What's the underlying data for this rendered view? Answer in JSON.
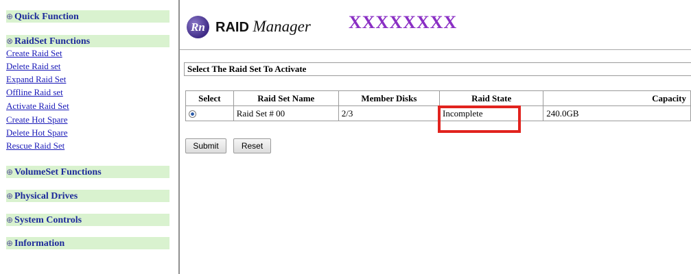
{
  "sidebar": {
    "quick_function": {
      "toggle": "⊕",
      "label": "Quick Function"
    },
    "raidset_functions": {
      "toggle": "⊗",
      "label": "RaidSet Functions"
    },
    "raidset_links": [
      "Create Raid Set",
      "Delete Raid set",
      "Expand Raid Set",
      "Offline Raid set",
      "Activate Raid Set",
      "Create Hot Spare",
      "Delete Hot Spare",
      "Rescue Raid Set"
    ],
    "volumeset_functions": {
      "toggle": "⊕",
      "label": "VolumeSet Functions"
    },
    "physical_drives": {
      "toggle": "⊕",
      "label": "Physical Drives"
    },
    "system_controls": {
      "toggle": "⊕",
      "label": "System Controls"
    },
    "information": {
      "toggle": "⊕",
      "label": "Information"
    }
  },
  "header": {
    "logo_badge": "Rn",
    "logo_raid": "RAID",
    "logo_manager": "Manager",
    "model": "XXXXXXXX"
  },
  "panel": {
    "title": "Select The Raid Set To Activate"
  },
  "table": {
    "headers": [
      "Select",
      "Raid Set Name",
      "Member Disks",
      "Raid State",
      "Capacity"
    ],
    "row": {
      "name": "Raid Set # 00",
      "members": "2/3",
      "state": "Incomplete",
      "capacity": "240.0GB"
    }
  },
  "buttons": {
    "submit": "Submit",
    "reset": "Reset"
  },
  "colors": {
    "section_bg": "#d9f2cf",
    "section_text": "#1d2a9a",
    "link": "#1919b8",
    "highlight": "#e1231e",
    "model": "#8a2fc4"
  }
}
